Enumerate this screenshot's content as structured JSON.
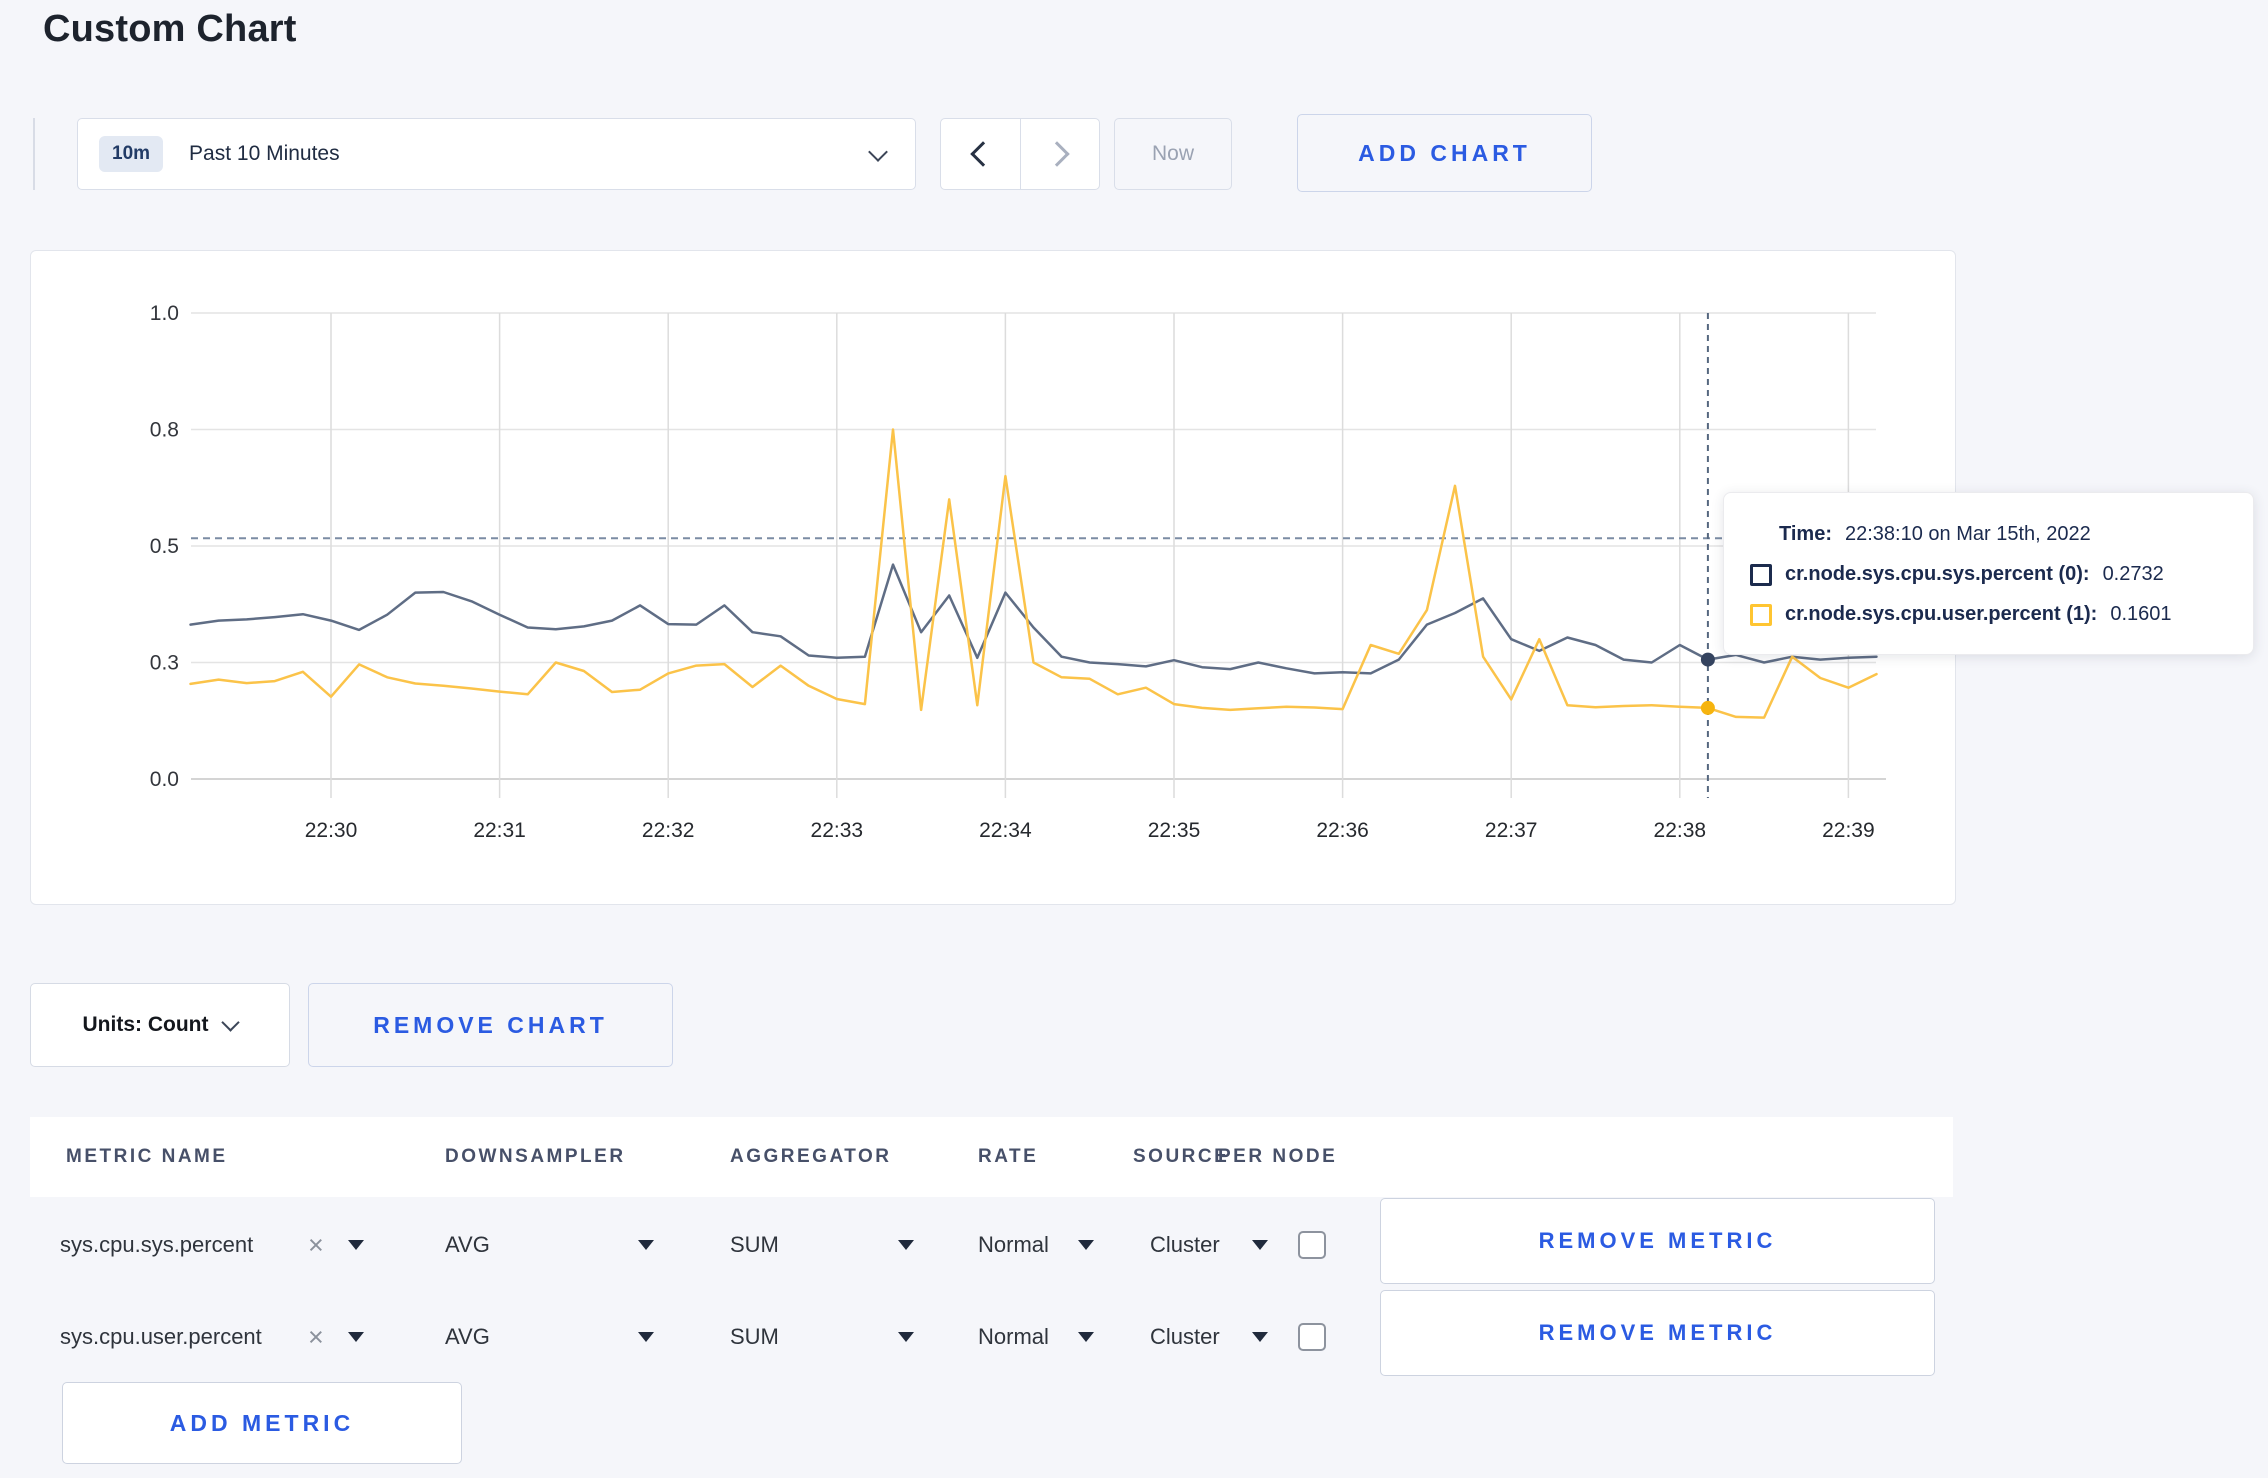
{
  "page": {
    "title": "Custom Chart"
  },
  "colors": {
    "accent_blue": "#2b5be2",
    "series_sys": "#5f6d85",
    "series_user": "#fbc349",
    "sys_dot": "#34435f",
    "user_dot": "#f6b40e",
    "crosshair": "#56677f",
    "threshold_dash": "#7b8ca4",
    "grid_h": "#e4e4e4",
    "grid_v": "#dcdcdc",
    "axis_bottom": "#c5c5c5"
  },
  "toolbar": {
    "range_badge": "10m",
    "range_label": "Past 10 Minutes",
    "now_label": "Now",
    "add_chart_label": "ADD CHART"
  },
  "chart_controls": {
    "units_label": "Units: Count",
    "remove_chart_label": "REMOVE CHART"
  },
  "tooltip": {
    "time_label": "Time:",
    "time_value": "22:38:10 on Mar 15th, 2022",
    "series": [
      {
        "label": "cr.node.sys.cpu.sys.percent (0):",
        "value": "0.2732",
        "swatch": "#1c2b4d"
      },
      {
        "label": "cr.node.sys.cpu.user.percent (1):",
        "value": "0.1601",
        "swatch": "#ffc531"
      }
    ]
  },
  "metrics_table": {
    "headers": [
      "METRIC NAME",
      "DOWNSAMPLER",
      "AGGREGATOR",
      "RATE",
      "SOURCE",
      "PER NODE"
    ],
    "remove_metric_label": "REMOVE METRIC",
    "add_metric_label": "ADD METRIC",
    "clear_icon": "×",
    "rows": [
      {
        "metric": "sys.cpu.sys.percent",
        "downsampler": "AVG",
        "aggregator": "SUM",
        "rate": "Normal",
        "source": "Cluster",
        "per_node_checked": false
      },
      {
        "metric": "sys.cpu.user.percent",
        "downsampler": "AVG",
        "aggregator": "SUM",
        "rate": "Normal",
        "source": "Cluster",
        "per_node_checked": false
      }
    ]
  },
  "chart_data": {
    "type": "line",
    "title": "",
    "xlabel": "",
    "ylabel": "",
    "grid": true,
    "legend_position": "tooltip",
    "y_ticks": [
      0.0,
      0.3,
      0.5,
      0.8,
      1.0
    ],
    "y_tick_labels": [
      "0.0",
      "0.3",
      "0.5",
      "0.8",
      "1.0"
    ],
    "x_tick_labels": [
      "22:30",
      "22:31",
      "22:32",
      "22:33",
      "22:34",
      "22:35",
      "22:36",
      "22:37",
      "22:38",
      "22:39"
    ],
    "start_time": "22:29:10 on Mar 15th, 2022",
    "sample_interval_sec": 10,
    "start_offset_sec": -50,
    "threshold_value": 0.52,
    "crosshair": {
      "time": "22:38:10",
      "offset_sec": 490,
      "sys_value": 0.305,
      "user_value": 0.183
    },
    "series": [
      {
        "name": "cr.node.sys.cpu.sys.percent",
        "color": "#5f6d85",
        "values": [
          0.365,
          0.372,
          0.374,
          0.378,
          0.383,
          0.372,
          0.356,
          0.382,
          0.42,
          0.421,
          0.405,
          0.382,
          0.36,
          0.357,
          0.362,
          0.372,
          0.398,
          0.366,
          0.365,
          0.398,
          0.352,
          0.345,
          0.312,
          0.308,
          0.31,
          0.468,
          0.352,
          0.415,
          0.308,
          0.42,
          0.36,
          0.31,
          0.3,
          0.296,
          0.29,
          0.304,
          0.288,
          0.283,
          0.3,
          0.285,
          0.272,
          0.275,
          0.272,
          0.305,
          0.365,
          0.385,
          0.41,
          0.34,
          0.32,
          0.343,
          0.33,
          0.305,
          0.3,
          0.33,
          0.305,
          0.313,
          0.3,
          0.31,
          0.305,
          0.308,
          0.31
        ]
      },
      {
        "name": "cr.node.sys.cpu.user.percent",
        "color": "#fbc349",
        "values": [
          0.245,
          0.256,
          0.247,
          0.252,
          0.276,
          0.212,
          0.295,
          0.262,
          0.246,
          0.24,
          0.233,
          0.225,
          0.218,
          0.3,
          0.278,
          0.224,
          0.23,
          0.272,
          0.292,
          0.296,
          0.237,
          0.292,
          0.24,
          0.206,
          0.193,
          0.8,
          0.178,
          0.62,
          0.19,
          0.68,
          0.3,
          0.262,
          0.258,
          0.218,
          0.235,
          0.193,
          0.183,
          0.178,
          0.182,
          0.186,
          0.184,
          0.18,
          0.33,
          0.315,
          0.39,
          0.655,
          0.31,
          0.205,
          0.34,
          0.19,
          0.185,
          0.188,
          0.19,
          0.186,
          0.183,
          0.16,
          0.158,
          0.31,
          0.26,
          0.235,
          0.27
        ]
      }
    ]
  }
}
